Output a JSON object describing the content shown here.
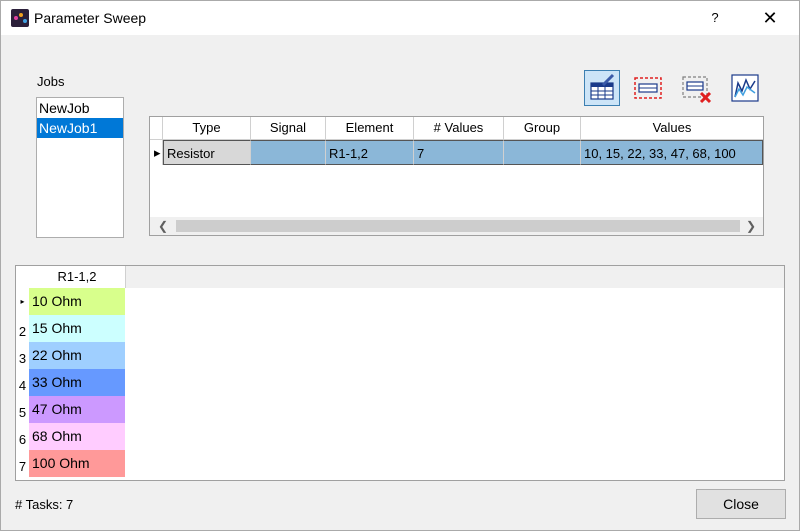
{
  "window": {
    "title": "Parameter Sweep",
    "help": "?",
    "close": "✕"
  },
  "jobs": {
    "label": "Jobs",
    "items": [
      {
        "name": "NewJob"
      },
      {
        "name": "NewJob1"
      }
    ]
  },
  "toolbar": {
    "icons": [
      "edit-table-icon",
      "select-dashed-icon",
      "delete-row-icon",
      "plot-chart-icon"
    ]
  },
  "sweep_table": {
    "headers": [
      "Type",
      "Signal",
      "Element",
      "# Values",
      "Group",
      "Values"
    ],
    "rows": [
      {
        "type": "Resistor",
        "signal": "",
        "element": "R1-1,2",
        "num_values": "7",
        "group": "",
        "values": "10, 15, 22, 33, 47, 68, 100"
      }
    ]
  },
  "value_grid": {
    "column": "R1-1,2",
    "rows": [
      {
        "num": "",
        "value": "10 Ohm",
        "color": "#d8ff8c"
      },
      {
        "num": "2",
        "value": "15 Ohm",
        "color": "#ccffff"
      },
      {
        "num": "3",
        "value": "22 Ohm",
        "color": "#9fcfff"
      },
      {
        "num": "4",
        "value": "33 Ohm",
        "color": "#6699ff"
      },
      {
        "num": "5",
        "value": "47 Ohm",
        "color": "#cc99ff"
      },
      {
        "num": "6",
        "value": "68 Ohm",
        "color": "#ffccff"
      },
      {
        "num": "7",
        "value": "100 Ohm",
        "color": "#ff9999"
      }
    ]
  },
  "footer": {
    "tasks_text": "# Tasks: 7",
    "close_label": "Close"
  }
}
